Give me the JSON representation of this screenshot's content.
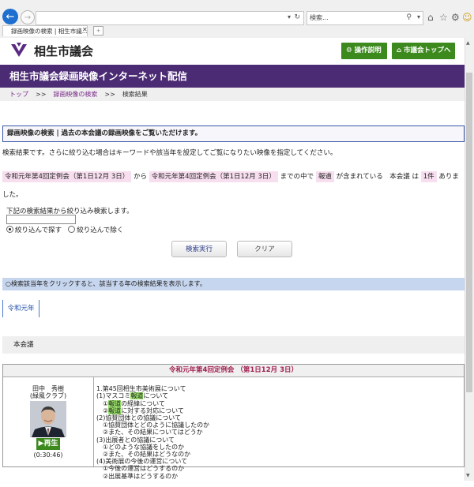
{
  "browser": {
    "address": "",
    "search_placeholder": "検索...",
    "tab_title": "録画映像の検索 | 相生市議..."
  },
  "site": {
    "title": "相生市議会",
    "help_button": "操作説明",
    "top_button": "市議会トップへ",
    "banner": "相生市議会録画映像インターネット配信"
  },
  "breadcrumb": {
    "top": "トップ",
    "sep": ">>",
    "video_search": "録画映像の検索",
    "current": "検索結果"
  },
  "search": {
    "box_title": "録画映像の検索 | 過去の本会議の録画映像をご覧いただけます。",
    "result_desc": "検索結果です。さらに絞り込む場合はキーワードや該当年を設定してご覧になりたい映像を指定してください。",
    "cond_from": "令和元年第4回定例会（第1日12月 3日）",
    "cond_kara": "から",
    "cond_to": "令和元年第4回定例会（第1日12月 3日）",
    "cond_made": "までの中で",
    "cond_keyword": "報道",
    "cond_included": "が含まれている　本会議 は",
    "cond_count": "1件",
    "cond_end": "ありました。",
    "narrow_label": "下記の検索結果から絞り込み検索します。",
    "radio_narrow": "絞り込んで探す",
    "radio_exclude": "絞り込んで除く",
    "exec_button": "検索実行",
    "clear_button": "クリア"
  },
  "year_note": "○検索該当年をクリックすると、該当する年の検索結果を表示します。",
  "year_tab": "令和元年",
  "meeting_type": "本会議",
  "session": {
    "header": "令和元年第4回定例会 （第1日12月 3日）",
    "speaker_name": "田中　秀樹",
    "speaker_group": "(緑風クラブ)",
    "play_label": "再生",
    "duration": "(0:30:46)",
    "agenda": [
      "1.第45回相生市美術展について",
      "(1)マスコミ報道について",
      "　①報道の経緯について",
      "　②報道に対する対応について",
      "(2)協賛団体との協議について",
      "　①協賛団体とどのように協議したのか",
      "　②また、その結果についてはどうか",
      "(3)出展者との協議について",
      "　①どのような協議をしたのか",
      "　②また、その結果はどうなのか",
      "(4)美術展の今後の運営について",
      "　①今後の運営はどうするのか",
      "　②出展基準はどうするのか"
    ]
  },
  "colors": {
    "banner": "#4b2b74",
    "green_button": "#3c8a1e",
    "highlight": "#f8dff0",
    "year_note_bg": "#c7d6ef",
    "keyword_mark": "#9be36a"
  }
}
